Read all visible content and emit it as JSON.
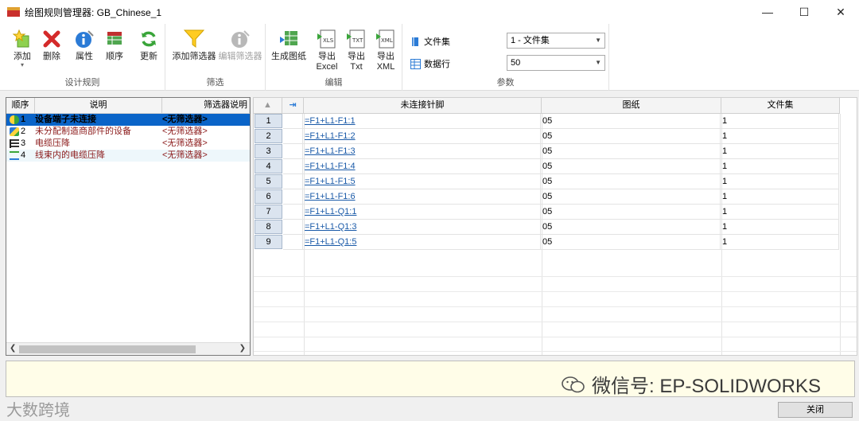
{
  "window": {
    "title": "绘图规则管理器: GB_Chinese_1",
    "controls": [
      "minimize-icon",
      "maximize-icon",
      "close-icon"
    ]
  },
  "ribbon": {
    "groups": {
      "design_rules": "设计规则",
      "filter": "筛选",
      "edit": "编辑",
      "params": "参数"
    },
    "buttons": {
      "add": "添加",
      "delete": "删除",
      "properties": "属性",
      "order": "顺序",
      "update": "更新",
      "add_filter": "添加筛选器",
      "edit_filter": "编辑筛选器",
      "generate_drawing": "生成图纸",
      "export_excel_1": "导出",
      "export_excel_2": "Excel",
      "export_txt_1": "导出",
      "export_txt_2": "Txt",
      "export_xml_1": "导出",
      "export_xml_2": "XML"
    },
    "params": {
      "file_set_label": "文件集",
      "file_set_value": "1 - 文件集",
      "data_rows_label": "数据行",
      "data_rows_value": "50"
    }
  },
  "rules_list": {
    "headers": [
      "顺序",
      "说明",
      "筛选器说明"
    ],
    "rows": [
      {
        "order": "1",
        "desc": "设备端子未连接",
        "filter": "<无筛选器>",
        "selected": true
      },
      {
        "order": "2",
        "desc": "未分配制造商部件的设备",
        "filter": "<无筛选器>"
      },
      {
        "order": "3",
        "desc": "电缆压降",
        "filter": "<无筛选器>"
      },
      {
        "order": "4",
        "desc": "线束内的电缆压降",
        "filter": "<无筛选器>"
      }
    ]
  },
  "results_grid": {
    "headers": [
      "未连接针脚",
      "图纸",
      "文件集"
    ],
    "rows": [
      {
        "n": "1",
        "pin": "=F1+L1-F1:1",
        "drawing": "05",
        "fileset": "1"
      },
      {
        "n": "2",
        "pin": "=F1+L1-F1:2",
        "drawing": "05",
        "fileset": "1"
      },
      {
        "n": "3",
        "pin": "=F1+L1-F1:3",
        "drawing": "05",
        "fileset": "1"
      },
      {
        "n": "4",
        "pin": "=F1+L1-F1:4",
        "drawing": "05",
        "fileset": "1"
      },
      {
        "n": "5",
        "pin": "=F1+L1-F1:5",
        "drawing": "05",
        "fileset": "1"
      },
      {
        "n": "6",
        "pin": "=F1+L1-F1:6",
        "drawing": "05",
        "fileset": "1"
      },
      {
        "n": "7",
        "pin": "=F1+L1-Q1:1",
        "drawing": "05",
        "fileset": "1"
      },
      {
        "n": "8",
        "pin": "=F1+L1-Q1:3",
        "drawing": "05",
        "fileset": "1"
      },
      {
        "n": "9",
        "pin": "=F1+L1-Q1:5",
        "drawing": "05",
        "fileset": "1"
      }
    ]
  },
  "watermark": {
    "text": "微信号: EP-SOLIDWORKS",
    "text2": "大数跨境"
  },
  "footer": {
    "close_label": "关闭"
  },
  "colors": {
    "selection": "#0a64c8",
    "link": "#1a5aa8",
    "description_bg": "#fffde8"
  }
}
